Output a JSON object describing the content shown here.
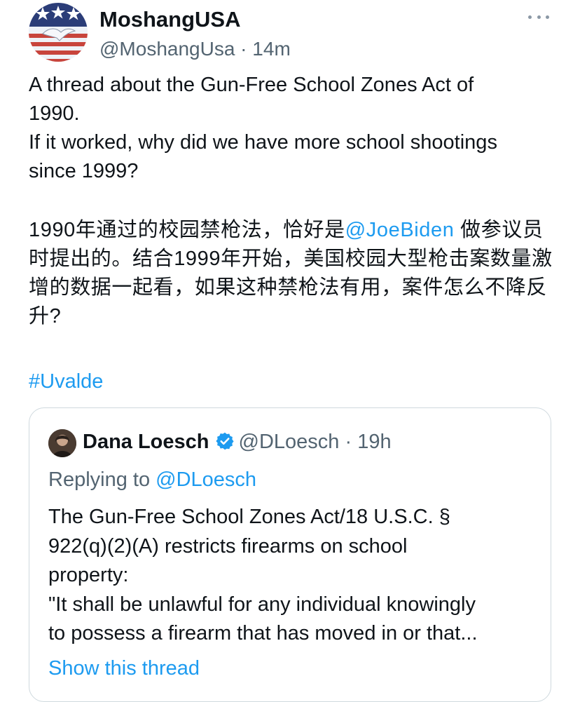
{
  "tweet": {
    "author": {
      "name": "MoshangUSA",
      "handle": "@MoshangUsa",
      "separator": " · ",
      "time": "14m"
    },
    "text_en": {
      "line1": "A thread about the Gun-Free School Zones Act of",
      "line2": "1990.",
      "line3": "If it worked, why did we have more school shootings",
      "line4": "since 1999?"
    },
    "text_cn": {
      "before_mention": "1990年通过的校园禁枪法，恰好是",
      "mention": "@JoeBiden",
      "after_mention": " 做参议员时提出的。结合1999年开始，美国校园大型枪击案数量激增的数据一起看，如果这种禁枪法有用，案件怎么不降反升?"
    },
    "hashtag": "#Uvalde",
    "colors": {
      "accent": "#1d9bf0",
      "text": "#0f1419",
      "secondary": "#536471"
    },
    "icons": {
      "avatar": "american-flag-eagle-avatar",
      "more": "more-dots-icon"
    }
  },
  "quote": {
    "name": "Dana Loesch",
    "handle": "@DLoesch",
    "separator": " · ",
    "time": "19h",
    "replying_prefix": "Replying to ",
    "replying_handle": "@DLoesch",
    "text": {
      "line1": "The Gun-Free School Zones Act/18 U.S.C. §",
      "line2": "922(q)(2)(A) restricts firearms on school",
      "line3": "property:",
      "line4": "\"It shall be unlawful for any individual knowingly",
      "line5": "to possess a firearm that has moved in or that..."
    },
    "show_thread": "Show this thread",
    "icons": {
      "avatar": "profile-photo-avatar",
      "verified": "verified-badge-icon"
    }
  }
}
